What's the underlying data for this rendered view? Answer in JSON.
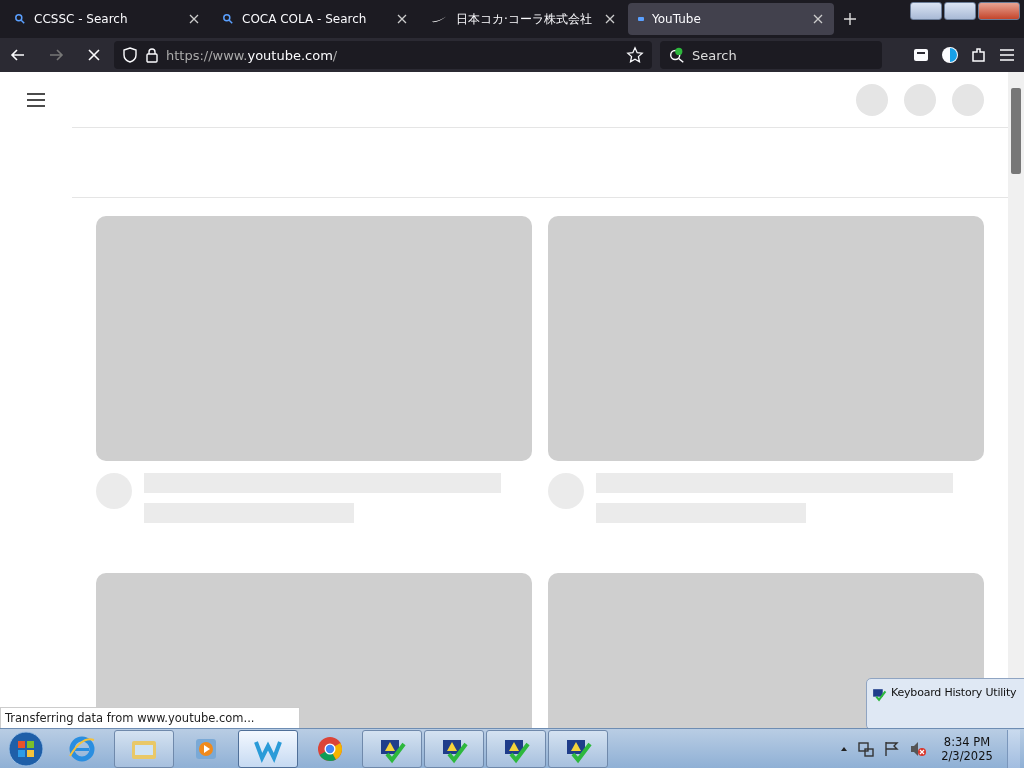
{
  "tabs": [
    {
      "title": "CCSSC - Search",
      "kind": "search",
      "selected": false
    },
    {
      "title": "COCA COLA - Search",
      "kind": "search",
      "selected": false
    },
    {
      "title": "日本コカ·コーラ株式会社",
      "kind": "brand",
      "selected": false
    },
    {
      "title": "YouTube",
      "kind": "video",
      "selected": true
    }
  ],
  "toolbar": {
    "url_prefix": "https://www.",
    "url_host": "youtube.com",
    "url_suffix": "/",
    "search_placeholder": "Search",
    "loading": true
  },
  "status": "Transferring data from www.youtube.com...",
  "popup": {
    "title": "Keyboard History Utility"
  },
  "taskbar": {
    "apps": [
      {
        "kind": "ie",
        "running": false,
        "selected": false
      },
      {
        "kind": "folder",
        "running": true,
        "selected": false
      },
      {
        "kind": "media",
        "running": false,
        "selected": false
      },
      {
        "kind": "w",
        "running": true,
        "selected": true
      },
      {
        "kind": "chrome",
        "running": false,
        "selected": false
      },
      {
        "kind": "utility",
        "running": true,
        "selected": false
      },
      {
        "kind": "utility",
        "running": true,
        "selected": false
      },
      {
        "kind": "utility",
        "running": true,
        "selected": false
      },
      {
        "kind": "utility",
        "running": true,
        "selected": false
      }
    ],
    "time": "8:34 PM",
    "date": "2/3/2025"
  }
}
